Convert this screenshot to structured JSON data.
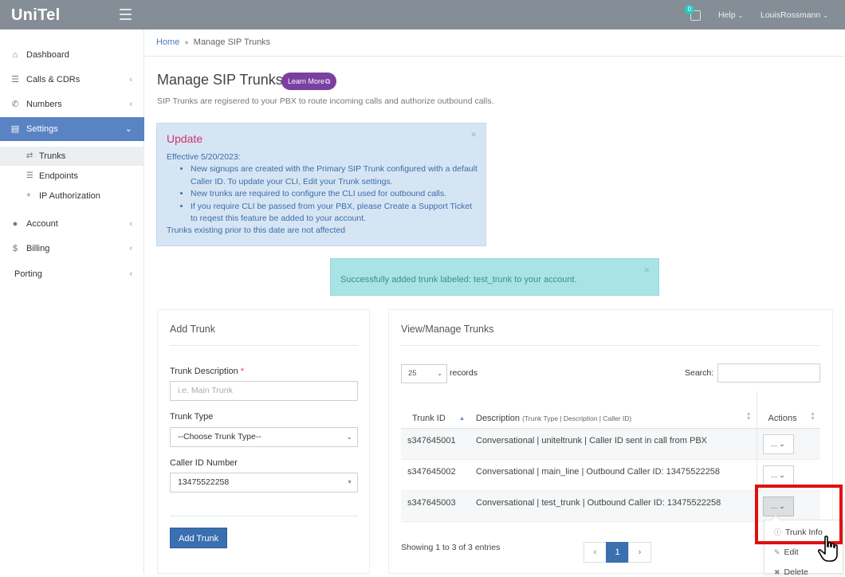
{
  "header": {
    "logo": "UniTel",
    "notifications_count": "0",
    "help_label": "Help",
    "user_label": "LouisRossmann"
  },
  "sidebar": {
    "items": [
      {
        "label": "Dashboard",
        "icon": "home-icon"
      },
      {
        "label": "Calls & CDRs",
        "icon": "list-icon"
      },
      {
        "label": "Numbers",
        "icon": "phone-icon"
      },
      {
        "label": "Settings",
        "icon": "settings-icon",
        "active": true
      },
      {
        "label": "Account",
        "icon": "user-icon"
      },
      {
        "label": "Billing",
        "icon": "dollar-icon"
      },
      {
        "label": "Porting",
        "icon": ""
      }
    ],
    "subitems": [
      {
        "label": "Trunks",
        "icon": "exchange-icon",
        "current": true
      },
      {
        "label": "Endpoints",
        "icon": "list-icon"
      },
      {
        "label": "IP Authorization",
        "icon": "plus-icon"
      }
    ]
  },
  "breadcrumb": {
    "home": "Home",
    "current": "Manage SIP Trunks"
  },
  "page": {
    "title": "Manage SIP Trunks",
    "learn_more": "Learn More",
    "subtitle": "SIP Trunks are regisered to your PBX to route incoming calls and authorize outbound calls."
  },
  "update_alert": {
    "title": "Update",
    "effective": "Effective 5/20/2023:",
    "bullets": [
      "New signups are created with the Primary SIP Trunk configured with a default Caller ID. To update your CLI, Edit your Trunk settings.",
      "New trunks are required to configure the CLI used for outbound calls.",
      "If you require CLI be passed from your PBX, please Create a Support Ticket to reqest this feature be added to your account."
    ],
    "footer": "Trunks existing prior to this date are not affected"
  },
  "success_alert": {
    "text": "Successfully added trunk labeled: test_trunk to your account."
  },
  "add_trunk": {
    "title": "Add Trunk",
    "desc_label": "Trunk Description",
    "required_mark": "*",
    "desc_placeholder": "i.e. Main Trunk",
    "type_label": "Trunk Type",
    "type_value": "--Choose Trunk Type--",
    "caller_label": "Caller ID Number",
    "caller_value": "13475522258",
    "button": "Add Trunk"
  },
  "manage": {
    "title": "View/Manage Trunks",
    "records_value": "25",
    "records_label": "records",
    "search_label": "Search:",
    "columns": {
      "id": "Trunk ID",
      "desc": "Description",
      "desc_detail": "(Trunk Type | Description | Caller ID)",
      "actions": "Actions"
    },
    "rows": [
      {
        "id": "s347645001",
        "desc": "Conversational | uniteltrunk | Caller ID sent in call from PBX",
        "action": "..."
      },
      {
        "id": "s347645002",
        "desc": "Conversational | main_line | Outbound Caller ID: 13475522258",
        "action": "..."
      },
      {
        "id": "s347645003",
        "desc": "Conversational | test_trunk | Outbound Caller ID: 13475522258",
        "action": "..."
      }
    ],
    "showing": "Showing 1 to 3 of 3 entries",
    "pager": {
      "prev": "‹",
      "page": "1",
      "next": "›"
    }
  },
  "action_menu": {
    "items": [
      "Trunk Info",
      "Edit",
      "Delete"
    ]
  },
  "colors": {
    "topbar": "#858d96",
    "sidebar_active": "#5a83c3",
    "primary_button": "#3a6fb0",
    "learn_more": "#7b3fa0",
    "alert_info": "#d6e5f4",
    "alert_success": "#a8e3e6",
    "highlight": "#e01010"
  }
}
